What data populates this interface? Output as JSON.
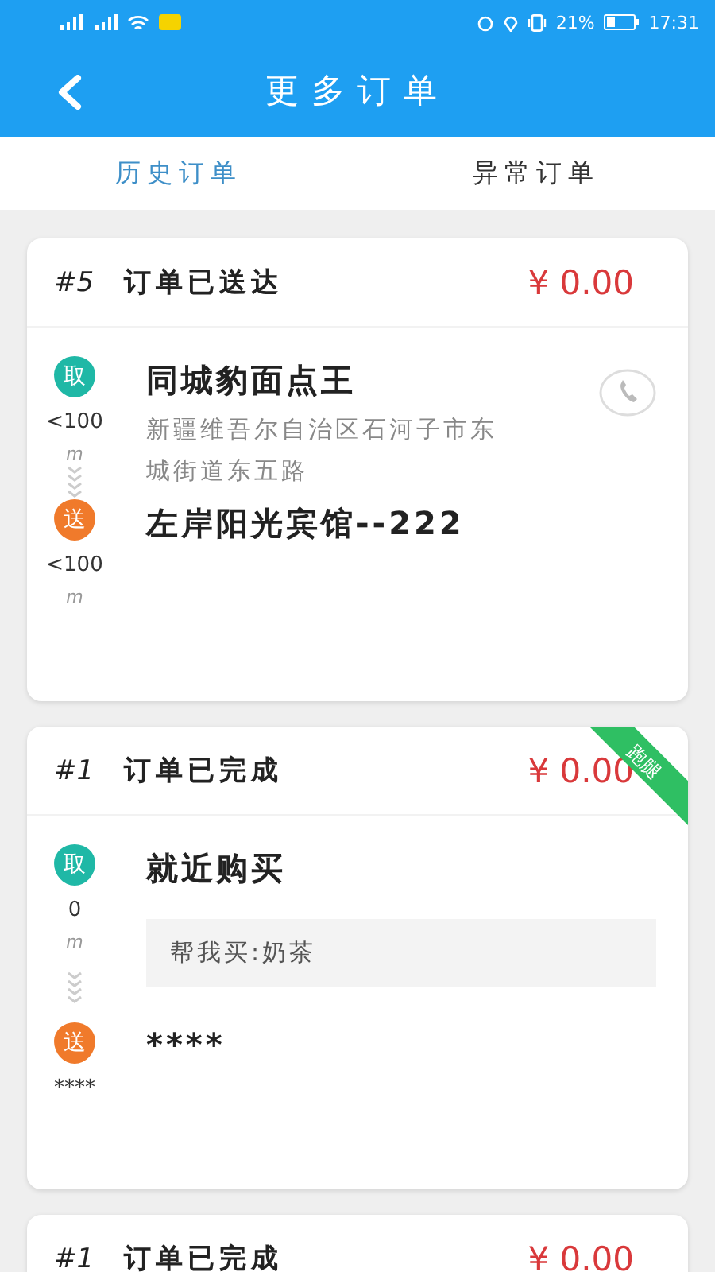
{
  "status_bar": {
    "battery": "21%",
    "time": "17:31"
  },
  "header": {
    "title": "更多订单"
  },
  "tabs": [
    {
      "label": "历史订单",
      "selected": true
    },
    {
      "label": "异常订单",
      "selected": false
    }
  ],
  "orders": [
    {
      "number": "#5",
      "status": "订单已送达",
      "price": "¥ 0.00",
      "phone": true,
      "stops": [
        {
          "kind": "pickup",
          "tag": "取",
          "distance": "<100",
          "unit": "m",
          "name": "同城豹面点王",
          "address": "新疆维吾尔自治区石河子市东城街道东五路"
        },
        {
          "kind": "dropoff",
          "tag": "送",
          "distance": "<100",
          "unit": "m",
          "name": "左岸阳光宾馆--222"
        }
      ]
    },
    {
      "number": "#1",
      "status": "订单已完成",
      "price": "¥ 0.00",
      "ribbon": "跑腿",
      "phone": false,
      "stops": [
        {
          "kind": "pickup",
          "tag": "取",
          "distance": "0",
          "unit": "m",
          "name": "就近购买",
          "note": "帮我买:奶茶"
        },
        {
          "kind": "dropoff",
          "tag": "送",
          "distance": "****",
          "name": "****"
        }
      ]
    },
    {
      "number": "#1",
      "status": "订单已完成",
      "price": "¥ 0.00"
    }
  ]
}
